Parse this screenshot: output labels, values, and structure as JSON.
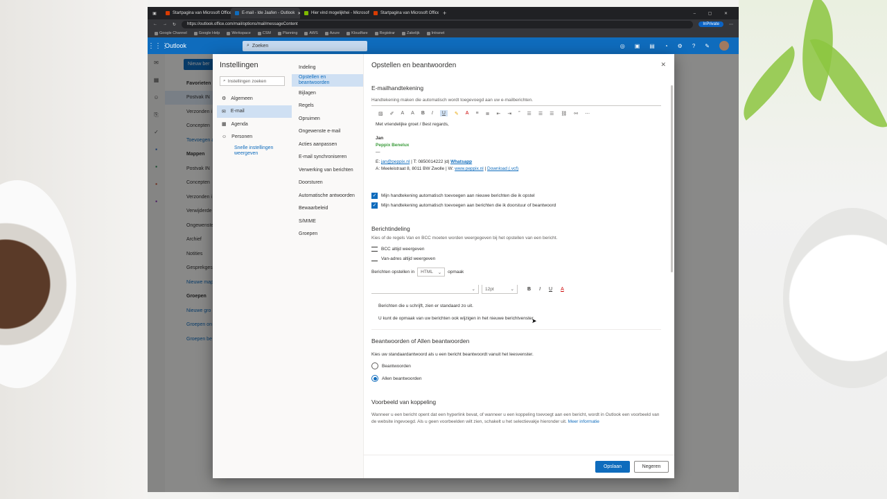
{
  "browser": {
    "tabs": [
      {
        "label": "Startpagina van Microsoft Office",
        "color": "#d83b01",
        "active": false
      },
      {
        "label": "E-mail - Ide Jaafen - Outlook",
        "color": "#0f6cbd",
        "active": true
      },
      {
        "label": "Hier vind mogelijkhei - Microsoft",
        "color": "#7fba00",
        "active": false
      },
      {
        "label": "Startpagina van Microsoft Office",
        "color": "#d83b01",
        "active": false
      }
    ],
    "url": "https://outlook.office.com/mail/options/mail/messageContent",
    "profile_label": "InPrivate",
    "bookmarks": [
      "Google Channel",
      "Google Help",
      "Werkspace",
      "CSM",
      "Planning",
      "AWS",
      "Azure",
      "Kloudfare",
      "Registrar",
      "Zakelijk",
      "Intranet"
    ]
  },
  "outlook": {
    "brand": "Outlook",
    "search_placeholder": "Zoeken",
    "new_mail_label": "Nieuw ber",
    "folders": [
      {
        "label": "Favorieten",
        "type": "hdr"
      },
      {
        "label": "Postvak IN",
        "type": "sel"
      },
      {
        "label": "Verzonden i",
        "type": "item"
      },
      {
        "label": "Concepten",
        "type": "item"
      },
      {
        "label": "Toevoegen a",
        "type": "link"
      },
      {
        "label": "Mappen",
        "type": "hdr"
      },
      {
        "label": "Postvak IN",
        "type": "item"
      },
      {
        "label": "Concepten",
        "type": "item"
      },
      {
        "label": "Verzonden i",
        "type": "item"
      },
      {
        "label": "Verwijderde",
        "type": "item"
      },
      {
        "label": "Ongewenste",
        "type": "item"
      },
      {
        "label": "Archief",
        "type": "item"
      },
      {
        "label": "Notities",
        "type": "item"
      },
      {
        "label": "Gesprekges",
        "type": "item"
      },
      {
        "label": "Nieuwe map",
        "type": "link"
      },
      {
        "label": "Groepen",
        "type": "hdr"
      },
      {
        "label": "Nieuwe gro",
        "type": "link"
      },
      {
        "label": "Groepen on",
        "type": "link"
      },
      {
        "label": "Groepen be",
        "type": "link"
      }
    ]
  },
  "settings": {
    "title": "Instellingen",
    "search_placeholder": "Instellingen zoeken",
    "nav": [
      {
        "label": "Algemeen",
        "icon": "gear-icon",
        "glyph": "⚙"
      },
      {
        "label": "E-mail",
        "icon": "mail-icon",
        "glyph": "✉"
      },
      {
        "label": "Agenda",
        "icon": "calendar-icon",
        "glyph": "▦"
      },
      {
        "label": "Personen",
        "icon": "people-icon",
        "glyph": "☺"
      }
    ],
    "quick_settings": "Snelle instellingen weergeven",
    "subnav": [
      "Indeling",
      "Opstellen en beantwoorden",
      "Bijlagen",
      "Regels",
      "Opruimen",
      "Ongewenste e-mail",
      "Acties aanpassen",
      "E-mail synchroniseren",
      "Verwerking van berichten",
      "Doorsturen",
      "Automatische antwoorden",
      "Bewaarbeleid",
      "S/MIME",
      "Groepen"
    ],
    "page_title": "Opstellen en beantwoorden",
    "signature": {
      "title": "E-mailhandtekening",
      "desc": "Handtekening maken die automatisch wordt toegevoegd aan uw e-mailberichten.",
      "line1": "Met vriendelijke groet / Best regards,",
      "name": "Jan",
      "company": "Peppix Benelux",
      "dash": "—",
      "contact_prefix": "E:",
      "email": "jan@peppix.nl",
      "phone_text": "| T: 0850014222 |d|",
      "whatsapp": "Whatsapp",
      "address": "A: Meeleistraat 8, 8011 BW Zwolle | W:",
      "website": "www.peppix.nl",
      "download": "Download (.vcf)",
      "check1": "Mijn handtekening automatisch toevoegen aan nieuwe berichten die ik opstel",
      "check2": "Mijn handtekening automatisch toevoegen aan berichten die ik doorstuur of beantwoord"
    },
    "format": {
      "title": "Berichtindeling",
      "desc": "Kies of de regels Van en BCC moeten worden weergegeven bij het opstellen van een bericht.",
      "bcc": "BCC altijd weergeven",
      "from": "Van-adres altijd weergeven",
      "compose_label": "Berichten opstellen in",
      "compose_value": "HTML",
      "compose_suffix": "opmaak",
      "font_size": "12pt",
      "preview1": "Berichten die u schrijft, zien er standaard zo uit.",
      "preview2": "U kunt de opmaak van uw berichten ook wijzigen in het nieuwe berichtvenster."
    },
    "reply": {
      "title": "Beantwoorden of Allen beantwoorden",
      "desc": "Kies uw standaardantwoord als u een bericht beantwoordt vanuit het leesvenster.",
      "opt1": "Beantwoorden",
      "opt2": "Allen beantwoorden"
    },
    "link_preview": {
      "title": "Voorbeeld van koppeling",
      "desc": "Wanneer u een bericht opent dat een hyperlink bevat, of wanneer u een koppeling toevoegt aan een bericht, wordt in Outlook een voorbeeld van de website ingevoegd. Als u geen voorbeelden wilt zien, schakelt u het selectievakje hieronder uit.",
      "more": "Meer informatie"
    },
    "save": "Opslaan",
    "cancel": "Negeren"
  }
}
